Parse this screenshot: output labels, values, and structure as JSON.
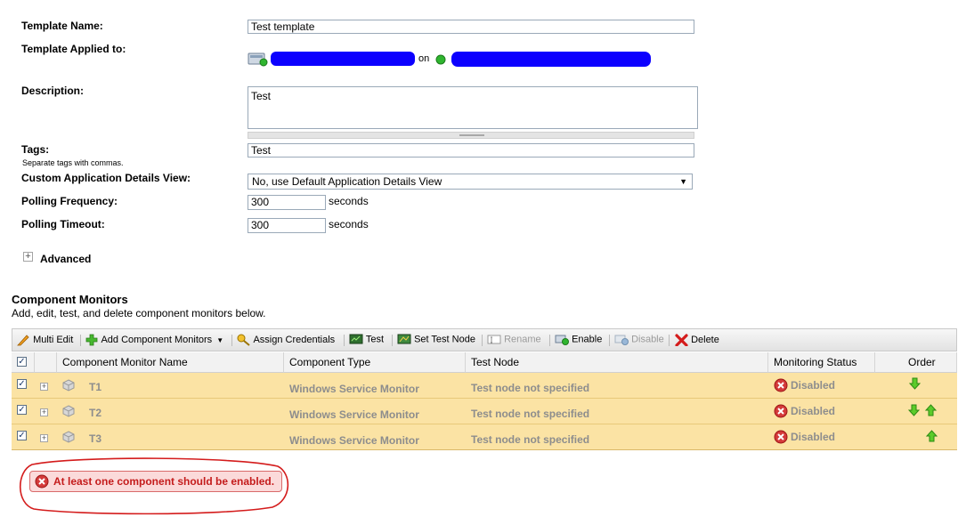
{
  "form": {
    "template_name_label": "Template Name:",
    "template_name_value": "Test template",
    "applied_to_label": "Template Applied to:",
    "applied_to_on": "on",
    "description_label": "Description:",
    "description_value": "Test",
    "tags_label": "Tags:",
    "tags_hint": "Separate tags with commas.",
    "tags_value": "Test",
    "details_view_label": "Custom Application Details View:",
    "details_view_value": "No, use Default Application Details View",
    "polling_frequency_label": "Polling Frequency:",
    "polling_frequency_value": "300",
    "polling_timeout_label": "Polling Timeout:",
    "polling_timeout_value": "300",
    "seconds_unit": "seconds",
    "advanced_label": "Advanced"
  },
  "monitors": {
    "title": "Component Monitors",
    "subtitle": "Add, edit, test, and delete component monitors below.",
    "toolbar": {
      "multi_edit": "Multi Edit",
      "add_component_monitors": "Add Component Monitors",
      "assign_credentials": "Assign Credentials",
      "test": "Test",
      "set_test_node": "Set Test Node",
      "rename": "Rename",
      "enable": "Enable",
      "disable": "Disable",
      "delete": "Delete"
    },
    "columns": [
      "Component Monitor Name",
      "Component Type",
      "Test Node",
      "Monitoring Status",
      "Order"
    ],
    "rows": [
      {
        "name": "T1",
        "type": "Windows Service Monitor",
        "test_node": "Test node not specified",
        "status": "Disabled"
      },
      {
        "name": "T2",
        "type": "Windows Service Monitor",
        "test_node": "Test node not specified",
        "status": "Disabled"
      },
      {
        "name": "T3",
        "type": "Windows Service Monitor",
        "test_node": "Test node not specified",
        "status": "Disabled"
      }
    ]
  },
  "validation": {
    "error_message": "At least one component should be enabled."
  },
  "colors": {
    "row_highlight": "#fbe3a4",
    "error_red": "#c41c1c",
    "redaction_blue": "#0c00ff",
    "arrow_green": "#3cb815"
  }
}
